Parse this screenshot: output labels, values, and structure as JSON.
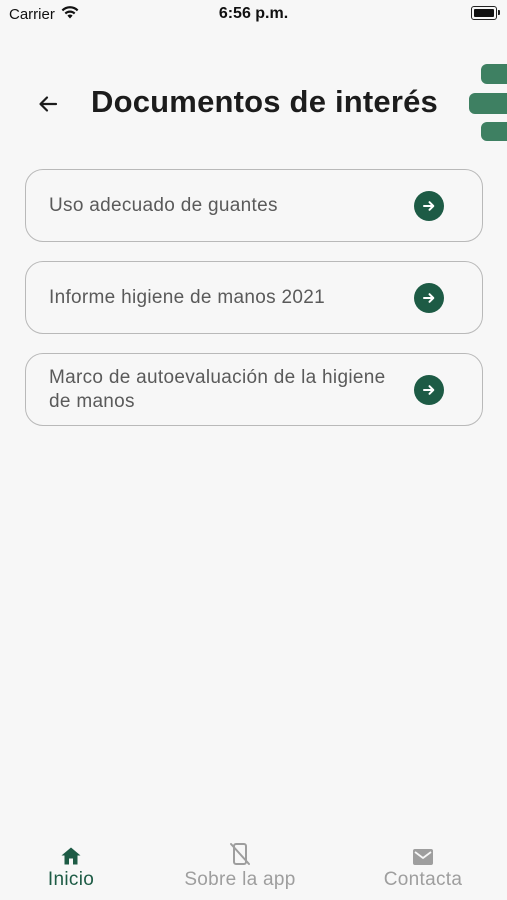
{
  "status_bar": {
    "carrier": "Carrier",
    "time": "6:56 p.m."
  },
  "header": {
    "title": "Documentos de interés",
    "back_icon": "arrow-left-icon"
  },
  "documents": [
    {
      "label": "Uso adecuado de guantes",
      "icon": "arrow-right-circle-icon"
    },
    {
      "label": "Informe higiene de manos 2021",
      "icon": "arrow-right-circle-icon"
    },
    {
      "label": "Marco de autoevaluación de la higiene de manos",
      "icon": "arrow-right-circle-icon"
    }
  ],
  "bottom_nav": {
    "items": [
      {
        "label": "Inicio",
        "icon": "home-icon",
        "active": true
      },
      {
        "label": "Sobre la app",
        "icon": "phone-off-icon",
        "active": false
      },
      {
        "label": "Contacta",
        "icon": "mail-icon",
        "active": false
      }
    ]
  },
  "colors": {
    "accent": "#1d5b45",
    "logo": "#3e8062",
    "background": "#f7f7f7",
    "inactive": "#9e9e9e"
  }
}
